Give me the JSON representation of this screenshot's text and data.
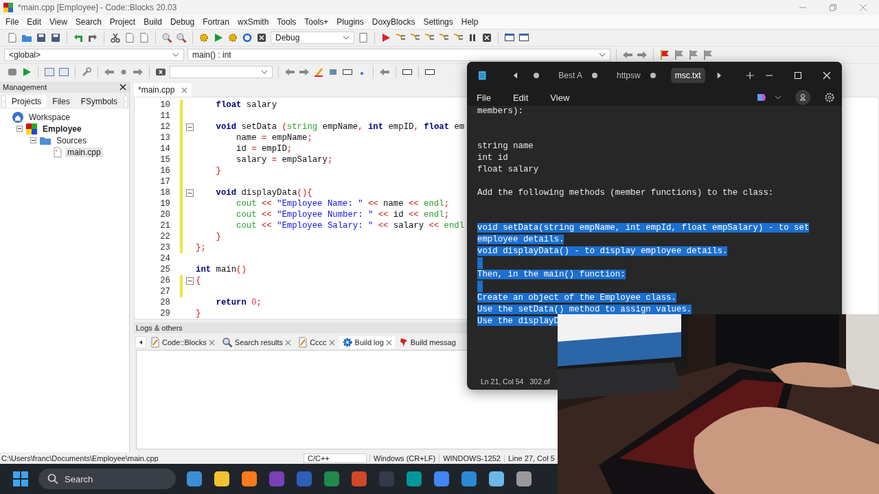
{
  "window": {
    "title": "*main.cpp [Employee] - Code::Blocks 20.03"
  },
  "menu": [
    "File",
    "Edit",
    "View",
    "Search",
    "Project",
    "Build",
    "Debug",
    "Fortran",
    "wxSmith",
    "Tools",
    "Tools+",
    "Plugins",
    "DoxyBlocks",
    "Settings",
    "Help"
  ],
  "build_target": "Debug",
  "scope": "<global>",
  "function": "main() : int",
  "management": {
    "title": "Management",
    "tabs": [
      {
        "label": "Projects",
        "selected": true
      },
      {
        "label": "Files",
        "selected": false
      },
      {
        "label": "FSymbols",
        "selected": false
      }
    ],
    "tree": [
      {
        "label": "Workspace",
        "kind": "workspace",
        "active": false,
        "selected": false,
        "children": [
          {
            "label": "Employee",
            "kind": "project",
            "active": true,
            "selected": false,
            "expanded": true,
            "children": [
              {
                "label": "Sources",
                "kind": "folder",
                "active": false,
                "selected": false,
                "expanded": true,
                "children": [
                  {
                    "label": "main.cpp",
                    "kind": "file",
                    "active": false,
                    "selected": true
                  }
                ]
              }
            ]
          }
        ]
      }
    ]
  },
  "editor": {
    "tab": "*main.cpp",
    "lines": [
      {
        "number": "10",
        "changed": true,
        "fold": false,
        "tokens": [
          {
            "text": "    float",
            "kind": "keyword"
          },
          {
            "text": " salary",
            "kind": "plain"
          }
        ]
      },
      {
        "number": "11",
        "changed": true,
        "fold": false
      },
      {
        "number": "12",
        "changed": true,
        "fold": true,
        "tokens": [
          {
            "text": "    void",
            "kind": "keyword"
          },
          {
            "text": " setData ",
            "kind": "plain"
          },
          {
            "text": "(",
            "kind": "op"
          },
          {
            "text": "string",
            "kind": "type"
          },
          {
            "text": " empName",
            "kind": "plain"
          },
          {
            "text": ",",
            "kind": "op"
          },
          {
            "text": " int",
            "kind": "keyword"
          },
          {
            "text": " empID",
            "kind": "plain"
          },
          {
            "text": ",",
            "kind": "op"
          },
          {
            "text": " float",
            "kind": "keyword"
          },
          {
            "text": " em",
            "kind": "plain"
          }
        ]
      },
      {
        "number": "13",
        "changed": true,
        "fold": false,
        "tokens": [
          {
            "text": "        name ",
            "kind": "plain"
          },
          {
            "text": "=",
            "kind": "op"
          },
          {
            "text": " empName",
            "kind": "plain"
          },
          {
            "text": ";",
            "kind": "op"
          }
        ]
      },
      {
        "number": "14",
        "changed": true,
        "fold": false,
        "tokens": [
          {
            "text": "        id ",
            "kind": "plain"
          },
          {
            "text": "=",
            "kind": "op"
          },
          {
            "text": " empID",
            "kind": "plain"
          },
          {
            "text": ";",
            "kind": "op"
          }
        ]
      },
      {
        "number": "15",
        "changed": true,
        "fold": false,
        "tokens": [
          {
            "text": "        salary ",
            "kind": "plain"
          },
          {
            "text": "=",
            "kind": "op"
          },
          {
            "text": " empSalary",
            "kind": "plain"
          },
          {
            "text": ";",
            "kind": "op"
          }
        ]
      },
      {
        "number": "16",
        "changed": true,
        "fold": false,
        "tokens": [
          {
            "text": "    }",
            "kind": "op"
          }
        ]
      },
      {
        "number": "17",
        "changed": true,
        "fold": false
      },
      {
        "number": "18",
        "changed": true,
        "fold": true,
        "tokens": [
          {
            "text": "    void",
            "kind": "keyword"
          },
          {
            "text": " displayData",
            "kind": "plain"
          },
          {
            "text": "(){",
            "kind": "op"
          }
        ]
      },
      {
        "number": "19",
        "changed": true,
        "fold": false,
        "tokens": [
          {
            "text": "        cout",
            "kind": "type"
          },
          {
            "text": " <<",
            "kind": "op"
          },
          {
            "text": " \"Employee Name: \"",
            "kind": "string"
          },
          {
            "text": " <<",
            "kind": "op"
          },
          {
            "text": " name",
            "kind": "plain"
          },
          {
            "text": " <<",
            "kind": "op"
          },
          {
            "text": " endl",
            "kind": "type"
          },
          {
            "text": ";",
            "kind": "op"
          }
        ]
      },
      {
        "number": "20",
        "changed": true,
        "fold": false,
        "tokens": [
          {
            "text": "        cout",
            "kind": "type"
          },
          {
            "text": " <<",
            "kind": "op"
          },
          {
            "text": " \"Employee Number: \"",
            "kind": "string"
          },
          {
            "text": " <<",
            "kind": "op"
          },
          {
            "text": " id",
            "kind": "plain"
          },
          {
            "text": " <<",
            "kind": "op"
          },
          {
            "text": " endl",
            "kind": "type"
          },
          {
            "text": ";",
            "kind": "op"
          }
        ]
      },
      {
        "number": "21",
        "changed": true,
        "fold": false,
        "tokens": [
          {
            "text": "        cout",
            "kind": "type"
          },
          {
            "text": " <<",
            "kind": "op"
          },
          {
            "text": " \"Employee Salary: \"",
            "kind": "string"
          },
          {
            "text": " <<",
            "kind": "op"
          },
          {
            "text": " salary",
            "kind": "plain"
          },
          {
            "text": " <<",
            "kind": "op"
          },
          {
            "text": " endl",
            "kind": "type"
          }
        ]
      },
      {
        "number": "22",
        "changed": true,
        "fold": false,
        "tokens": [
          {
            "text": "    }",
            "kind": "op"
          }
        ]
      },
      {
        "number": "23",
        "changed": true,
        "fold": false,
        "tokens": [
          {
            "text": "};",
            "kind": "op"
          }
        ]
      },
      {
        "number": "24",
        "changed": false,
        "fold": false
      },
      {
        "number": "25",
        "changed": false,
        "fold": false,
        "tokens": [
          {
            "text": "int",
            "kind": "keyword"
          },
          {
            "text": " main",
            "kind": "plain"
          },
          {
            "text": "()",
            "kind": "op"
          }
        ]
      },
      {
        "number": "26",
        "changed": true,
        "fold": true,
        "tokens": [
          {
            "text": "{",
            "kind": "op"
          }
        ]
      },
      {
        "number": "27",
        "changed": true,
        "fold": false
      },
      {
        "number": "28",
        "changed": false,
        "fold": false,
        "tokens": [
          {
            "text": "    return",
            "kind": "keyword"
          },
          {
            "text": " 0",
            "kind": "number"
          },
          {
            "text": ";",
            "kind": "op"
          }
        ]
      },
      {
        "number": "29",
        "changed": false,
        "fold": false,
        "tokens": [
          {
            "text": "}",
            "kind": "op"
          }
        ]
      }
    ]
  },
  "logs": {
    "title": "Logs & others",
    "tabs": [
      {
        "label": "Code::Blocks",
        "kind": "pencil",
        "selected": false,
        "closable": true
      },
      {
        "label": "Search results",
        "kind": "search",
        "selected": false,
        "closable": true
      },
      {
        "label": "Cccc",
        "kind": "pencil",
        "selected": false,
        "closable": true
      },
      {
        "label": "Build log",
        "kind": "gear",
        "selected": true,
        "closable": true
      },
      {
        "label": "Build messag",
        "kind": "pin",
        "selected": false,
        "closable": false
      }
    ]
  },
  "status_bar": {
    "path": "C:\\Users\\franc\\Documents\\Employee\\main.cpp",
    "language": "C/C++",
    "line_endings": "Windows (CR+LF)",
    "encoding": "WINDOWS-1252",
    "position": "Line 27, Col 5"
  },
  "notepad": {
    "tabs": [
      {
        "modified": true,
        "selected": false
      },
      {
        "label": "Best A",
        "modified": true,
        "selected": false
      },
      {
        "label": "httpsw",
        "modified": true,
        "selected": false
      },
      {
        "label": "msc.txt",
        "modified": false,
        "selected": true
      }
    ],
    "menu": [
      "File",
      "Edit",
      "View"
    ],
    "lines": [
      {
        "kind": "text",
        "text": "members):",
        "selected": false
      },
      {
        "kind": "blank",
        "selected": false
      },
      {
        "kind": "blank",
        "selected": false
      },
      {
        "kind": "text",
        "text": "string name",
        "selected": false
      },
      {
        "kind": "text",
        "text": "int id",
        "selected": false
      },
      {
        "kind": "text",
        "text": "float salary",
        "selected": false
      },
      {
        "kind": "blank",
        "selected": false
      },
      {
        "kind": "text",
        "text": "Add the following methods (member functions) to the class:",
        "selected": false
      },
      {
        "kind": "blank",
        "selected": false
      },
      {
        "kind": "blank",
        "selected": false
      },
      {
        "kind": "text",
        "text": "void setData(string empName, int empId, float empSalary) - to set",
        "selected": true
      },
      {
        "kind": "text",
        "text": "employee details.",
        "selected": true
      },
      {
        "kind": "text",
        "text": "void displayData() - to display employee details.",
        "selected": true
      },
      {
        "kind": "blank",
        "selected": true
      },
      {
        "kind": "text",
        "text": "Then, in the main() function:",
        "selected": true
      },
      {
        "kind": "blank",
        "selected": true
      },
      {
        "kind": "text",
        "text": "Create an object of the Employee class.",
        "selected": true
      },
      {
        "kind": "text",
        "text": "Use the setData() method to assign values.",
        "selected": true
      },
      {
        "kind": "text",
        "text": "Use the displayD",
        "selected": true
      }
    ],
    "status": [
      "Ln 21, Col 54",
      "302 of"
    ]
  },
  "taskbar": {
    "search_placeholder": "Search"
  }
}
